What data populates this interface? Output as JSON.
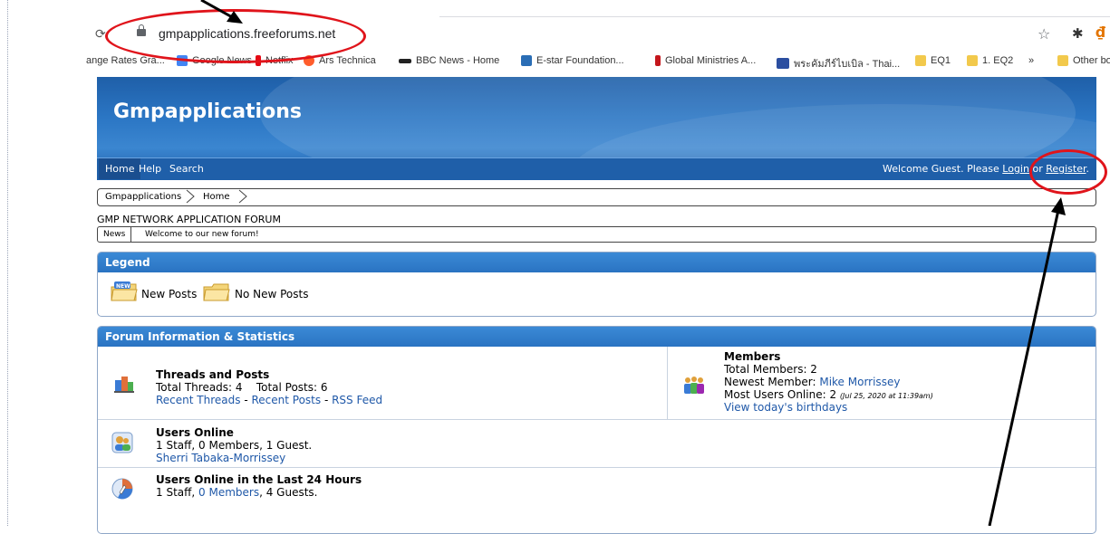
{
  "browser": {
    "url": "gmpapplications.freeforums.net",
    "bookmarks": [
      {
        "label": "ange Rates Gra...",
        "color": "#ffffff"
      },
      {
        "label": "Google News",
        "color": "#4285f4"
      },
      {
        "label": "Netflix",
        "color": "#e50914"
      },
      {
        "label": "Ars Technica",
        "color": "#ff5d2c"
      },
      {
        "label": "BBC News - Home",
        "color": "#222222"
      },
      {
        "label": "E-star Foundation...",
        "color": "#2a6db5"
      },
      {
        "label": "Global Ministries A...",
        "color": "#c4161c"
      },
      {
        "label": "พระคัมภีร์ไบเบิล - Thai...",
        "color": "#2b4ea0"
      },
      {
        "label": "EQ1",
        "color": "#f2c94c"
      },
      {
        "label": "1. EQ2",
        "color": "#f2c94c"
      },
      {
        "label": "»",
        "color": ""
      },
      {
        "label": "Other boo",
        "color": "#f2c94c"
      }
    ],
    "icons": [
      "reload-icon",
      "lock-icon",
      "star-icon",
      "extensions-icon",
      "profile-icon"
    ]
  },
  "site": {
    "title": "Gmpapplications",
    "nav": [
      "Home",
      "Help",
      "Search"
    ],
    "welcome_prefix": "Welcome Guest. Please ",
    "login": "Login",
    "or": " or ",
    "register": "Register",
    "period": "."
  },
  "breadcrumb": [
    "Gmpapplications",
    "Home"
  ],
  "forum_heading": "GMP NETWORK APPLICATION FORUM",
  "news": {
    "label": "News",
    "text": "Welcome to our new forum!"
  },
  "legend": {
    "title": "Legend",
    "new_posts": "New Posts",
    "no_new_posts": "No New Posts"
  },
  "stats": {
    "title": "Forum Information & Statistics",
    "threads": {
      "title": "Threads and Posts",
      "total_threads": "Total Threads: 4",
      "total_posts": "Total Posts: 6",
      "recent_threads": "Recent Threads",
      "recent_posts": "Recent Posts",
      "rss": "RSS Feed",
      "sep": " - "
    },
    "members": {
      "title": "Members",
      "total": "Total Members: 2",
      "newest_label": "Newest Member: ",
      "newest_name": "Mike Morrissey",
      "most_online": "Most Users Online: 2 ",
      "most_online_date": "(Jul 25, 2020 at 11:39am)",
      "birthdays": "View today's birthdays"
    },
    "online": {
      "title": "Users Online",
      "summary": "1 Staff, 0 Members, 1 Guest.",
      "user": "Sherri Tabaka-Morrissey"
    },
    "last24": {
      "title": "Users Online in the Last 24 Hours",
      "prefix": "1 Staff, ",
      "members_link": "0 Members",
      "suffix": ", 4 Guests."
    }
  },
  "annotation_color": "#e0141b"
}
